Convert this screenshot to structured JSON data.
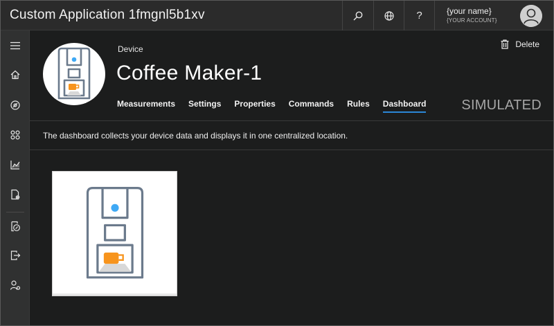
{
  "app": {
    "title": "Custom Application 1fmgnl5b1xv"
  },
  "topbar": {
    "search_icon": "search-icon",
    "globe_icon": "globe-icon",
    "help_label": "?",
    "account": {
      "name": "{your name}",
      "subtitle": "{YOUR ACCOUNT}"
    }
  },
  "sidebar": {
    "items": [
      {
        "icon": "hamburger-icon"
      },
      {
        "icon": "home-icon"
      },
      {
        "icon": "device-explorer-icon"
      },
      {
        "icon": "device-sets-icon"
      },
      {
        "icon": "analytics-icon"
      },
      {
        "icon": "device-templates-icon"
      },
      {
        "icon": "rules-icon"
      },
      {
        "icon": "data-export-icon"
      },
      {
        "icon": "administration-icon"
      }
    ]
  },
  "device": {
    "label": "Device",
    "name": "Coffee Maker-1",
    "delete_label": "Delete",
    "status": "SIMULATED",
    "tabs": [
      {
        "label": "Measurements",
        "active": false
      },
      {
        "label": "Settings",
        "active": false
      },
      {
        "label": "Properties",
        "active": false
      },
      {
        "label": "Commands",
        "active": false
      },
      {
        "label": "Rules",
        "active": false
      },
      {
        "label": "Dashboard",
        "active": true
      }
    ]
  },
  "dashboard": {
    "description": "The dashboard collects your device data and displays it in one centralized location."
  },
  "colors": {
    "accent": "#2b88d8",
    "cup": "#f7941d",
    "indicator": "#3fa9f5",
    "machine_stroke": "#6b7a8c"
  }
}
